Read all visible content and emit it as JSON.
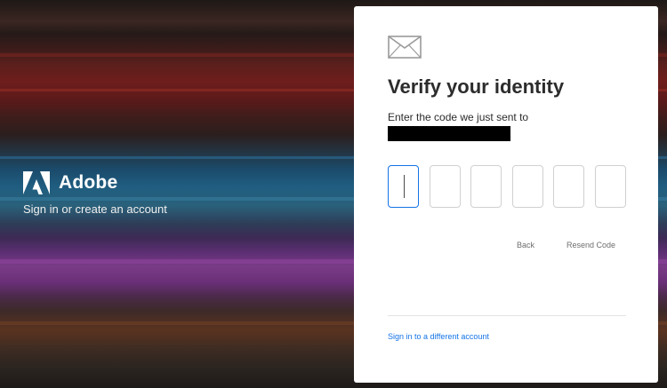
{
  "brand": {
    "name": "Adobe",
    "tagline": "Sign in or create an account",
    "logo_icon": "adobe-logo-icon"
  },
  "card": {
    "icon": "envelope-icon",
    "title": "Verify your identity",
    "subtitle": "Enter the code we just sent to",
    "code_boxes": [
      {
        "value": "",
        "active": true
      },
      {
        "value": "",
        "active": false
      },
      {
        "value": "",
        "active": false
      },
      {
        "value": "",
        "active": false
      },
      {
        "value": "",
        "active": false
      },
      {
        "value": "",
        "active": false
      }
    ],
    "back_label": "Back",
    "resend_label": "Resend Code",
    "alt_signin_label": "Sign in to a different account"
  },
  "colors": {
    "accent": "#1473e6",
    "title": "#2c2c2c",
    "muted": "#6e6e6e"
  }
}
